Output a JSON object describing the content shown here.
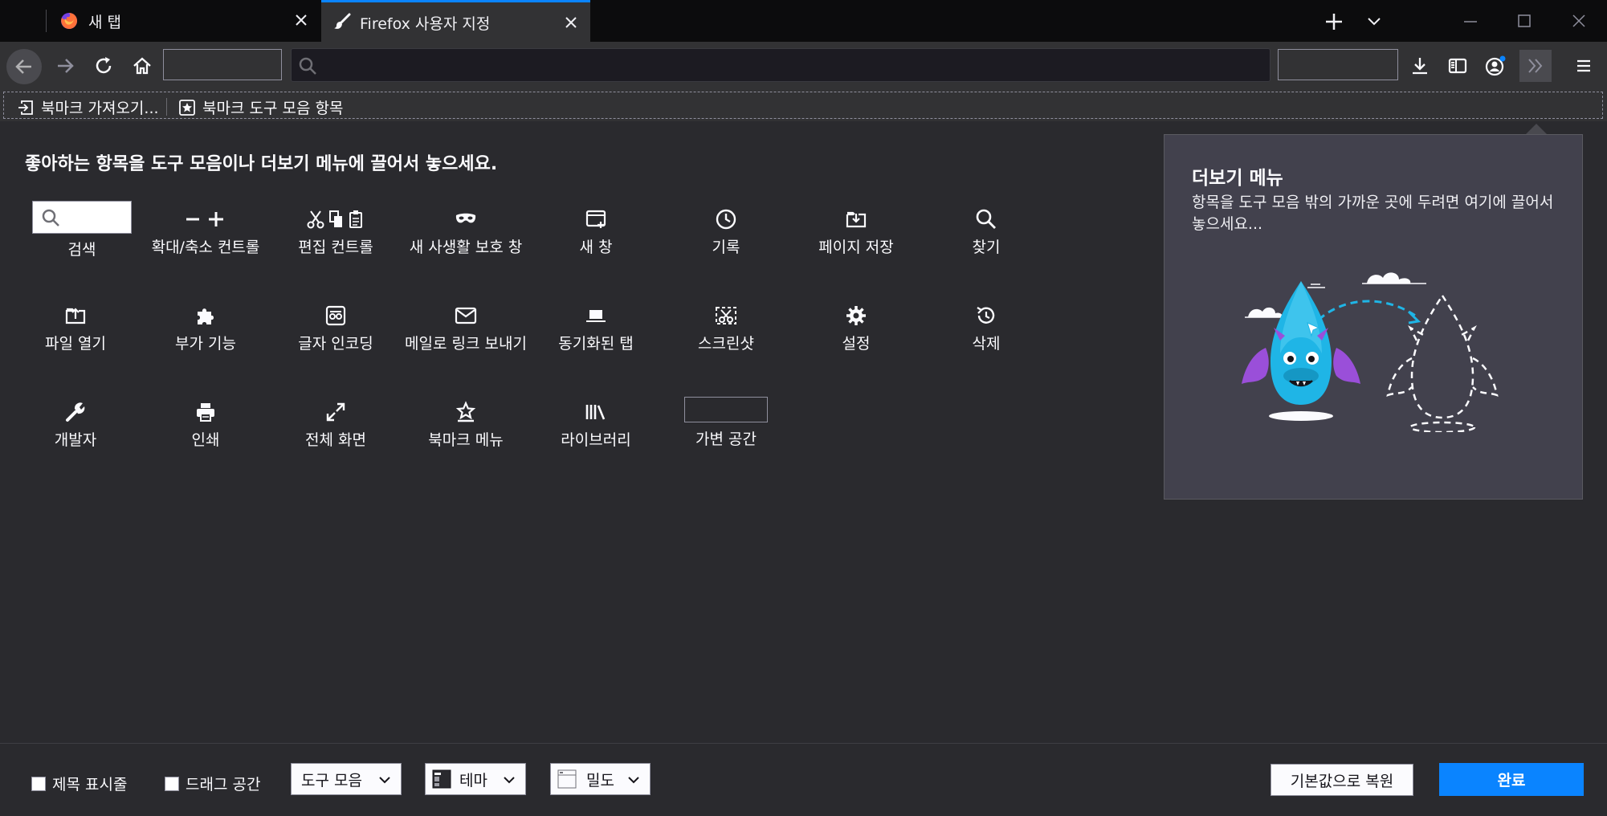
{
  "tabs": [
    {
      "label": "새 탭",
      "icon": "firefox-logo-icon",
      "active": false
    },
    {
      "label": "Firefox 사용자 지정",
      "icon": "brush-icon",
      "active": true
    }
  ],
  "toolbar": {
    "back": "back-arrow-icon",
    "forward": "forward-arrow-icon",
    "reload": "reload-icon",
    "home": "home-icon",
    "url_icon": "search-icon",
    "right_icons": [
      "download-icon",
      "sidebar-icon",
      "account-icon",
      "overflow-chevron-icon",
      "hamburger-menu-icon"
    ]
  },
  "bookmarks": {
    "items": [
      {
        "label": "북마크 가져오기...",
        "icon": "import-icon"
      },
      {
        "label": "북마크 도구 모음 항목",
        "icon": "bookmark-star-icon"
      }
    ]
  },
  "customize": {
    "hint": "좋아하는 항목을 도구 모음이나 더보기 메뉴에 끌어서 놓으세요.",
    "palette": [
      {
        "label": "검색",
        "icon": "search-box"
      },
      {
        "label": "확대/축소 컨트롤",
        "icon": "zoom-controls-icon"
      },
      {
        "label": "편집 컨트롤",
        "icon": "edit-controls-icon"
      },
      {
        "label": "새 사생활 보호 창",
        "icon": "private-mask-icon"
      },
      {
        "label": "새 창",
        "icon": "new-window-icon"
      },
      {
        "label": "기록",
        "icon": "history-clock-icon"
      },
      {
        "label": "페이지 저장",
        "icon": "save-page-icon"
      },
      {
        "label": "찾기",
        "icon": "find-icon"
      },
      {
        "label": "파일 열기",
        "icon": "open-file-icon"
      },
      {
        "label": "부가 기능",
        "icon": "addons-puzzle-icon"
      },
      {
        "label": "글자 인코딩",
        "icon": "text-encoding-icon"
      },
      {
        "label": "메일로 링크 보내기",
        "icon": "mail-icon"
      },
      {
        "label": "동기화된 탭",
        "icon": "synced-tabs-icon"
      },
      {
        "label": "스크린샷",
        "icon": "screenshot-icon"
      },
      {
        "label": "설정",
        "icon": "gear-icon"
      },
      {
        "label": "삭제",
        "icon": "forget-icon"
      },
      {
        "label": "개발자",
        "icon": "wrench-icon"
      },
      {
        "label": "인쇄",
        "icon": "print-icon"
      },
      {
        "label": "전체 화면",
        "icon": "fullscreen-icon"
      },
      {
        "label": "북마크 메뉴",
        "icon": "bookmark-menu-icon"
      },
      {
        "label": "라이브러리",
        "icon": "library-icon"
      },
      {
        "label": "가변 공간",
        "icon": "flexible-space-box"
      }
    ]
  },
  "overflow_panel": {
    "title": "더보기 메뉴",
    "description": "항목을 도구 모음 밖의 가까운 곳에 두려면 여기에 끌어서 놓으세요..."
  },
  "footer": {
    "title_bar_label": "제목 표시줄",
    "drag_space_label": "드래그 공간",
    "toolbars_label": "도구 모음",
    "themes_label": "테마",
    "density_label": "밀도",
    "restore_label": "기본값으로 복원",
    "done_label": "완료"
  },
  "colors": {
    "accent": "#0a84ff",
    "tab_strip": "#0c0c0d",
    "toolbar": "#323234",
    "background": "#2a2a2e",
    "panel": "#42414d",
    "dragon": "#1fb5e6",
    "wing": "#9a4fd9"
  }
}
